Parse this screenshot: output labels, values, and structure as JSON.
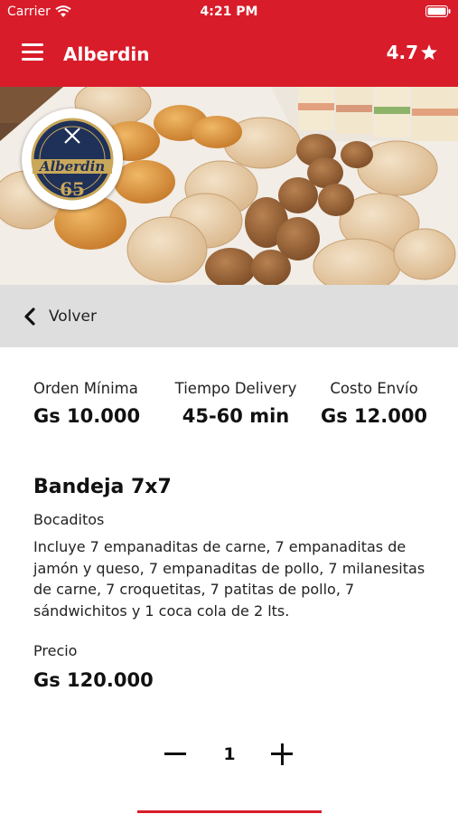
{
  "status_bar": {
    "carrier": "Carrier",
    "time": "4:21 PM",
    "icons": [
      "wifi-icon",
      "battery-icon"
    ]
  },
  "header": {
    "title": "Alberdin",
    "rating": "4.7",
    "rating_icon": "star-icon",
    "menu_icon": "hamburger-menu-icon",
    "background_color": "#d91c2a"
  },
  "hero": {
    "logo": {
      "brand": "Alberdin",
      "number": "65"
    }
  },
  "back": {
    "label": "Volver",
    "icon": "chevron-left-icon"
  },
  "info": {
    "min_order_label": "Orden Mínima",
    "min_order_value": "Gs 10.000",
    "delivery_time_label": "Tiempo Delivery",
    "delivery_time_value": "45-60 min",
    "delivery_cost_label": "Costo Envío",
    "delivery_cost_value": "Gs 12.000"
  },
  "product": {
    "title": "Bandeja 7x7",
    "category": "Bocaditos",
    "description": "Incluye 7 empanaditas de carne, 7 empanaditas de jamón y queso, 7 empanaditas de pollo, 7 milanesitas de carne, 7 croquetitas, 7 patitas de pollo, 7 sándwichitos y 1 coca cola de 2 lts.",
    "price_label": "Precio",
    "price": "Gs 120.000"
  },
  "quantity": {
    "value": "1",
    "decrement_icon": "minus-icon",
    "increment_icon": "plus-icon"
  },
  "colors": {
    "accent": "#d91c2a",
    "back_bar": "#dedede"
  }
}
